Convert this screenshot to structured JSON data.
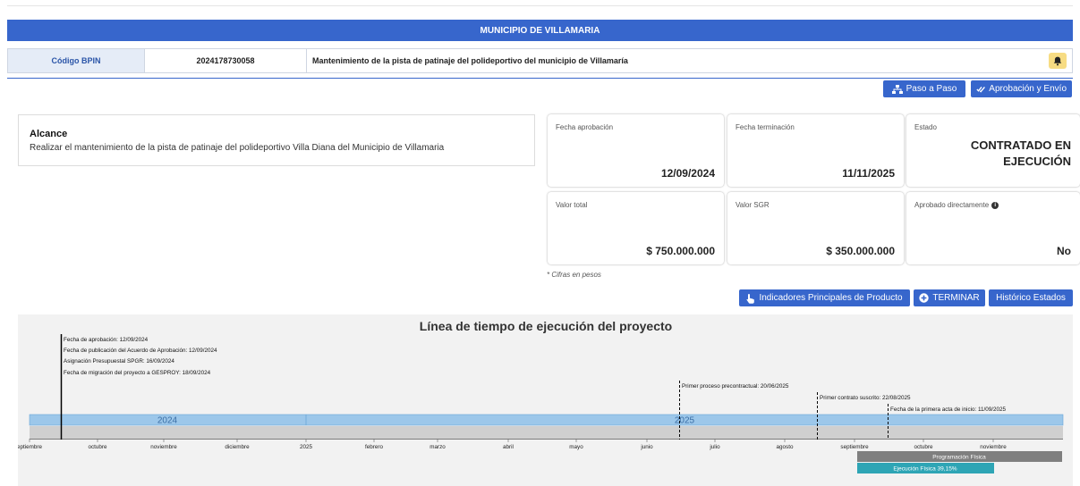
{
  "header": {
    "title": "MUNICIPIO DE VILLAMARIA"
  },
  "bpin": {
    "label": "Código BPIN",
    "code": "2024178730058",
    "description": "Mantenimiento de la pista de patinaje del polideportivo del municipio de Villamaría",
    "bell_icon": "bell-icon"
  },
  "actions": {
    "paso_a_paso": "Paso a Paso",
    "aprobacion_envio": "Aprobación y Envío",
    "indicadores": "Indicadores Principales de Producto",
    "terminar": "TERMINAR",
    "historico": "Histórico Estados"
  },
  "alcance": {
    "title": "Alcance",
    "text": "Realizar el mantenimiento de la pista de patinaje del polideportivo Villa Diana del Municipio de Villamaria"
  },
  "cards": {
    "fecha_aprobacion": {
      "label": "Fecha aprobación",
      "value": "12/09/2024"
    },
    "fecha_terminacion": {
      "label": "Fecha terminación",
      "value": "11/11/2025"
    },
    "estado": {
      "label": "Estado",
      "line1": "CONTRATADO EN",
      "line2": "EJECUCIÓN"
    },
    "valor_total": {
      "label": "Valor total",
      "value": "$ 750.000.000"
    },
    "valor_sgr": {
      "label": "Valor SGR",
      "value": "$ 350.000.000"
    },
    "aprobado_directamente": {
      "label": "Aprobado directamente",
      "value": "No"
    }
  },
  "cifras_note": "* Cifras en pesos",
  "timeline": {
    "title": "Línea de tiempo de ejecución del proyecto",
    "years": [
      "2024",
      "2025"
    ],
    "months": [
      "eptiembre",
      "octubre",
      "noviembre",
      "diciembre",
      "2025",
      "febrero",
      "marzo",
      "abril",
      "mayo",
      "junio",
      "julio",
      "agosto",
      "septiembre",
      "octubre",
      "noviembre"
    ],
    "events_group1": [
      "Fecha de aprobación: 12/09/2024",
      "Fecha de publicación del Acuerdo de Aprobación: 12/09/2024",
      "Asignación Presupuestal SPGR: 16/09/2024",
      "Fecha de migración del proyecto a GESPROY: 18/09/2024"
    ],
    "event_precontractual": "Primer proceso precontractual: 20/06/2025",
    "event_contrato": "Primer contrato suscrito: 22/08/2025",
    "event_acta": "Fecha de la primera acta de inicio: 11/09/2025",
    "programacion": "Programación Física",
    "ejecucion": "Ejecución Física 39,15%",
    "colors": {
      "band": "#9cc7ea",
      "programacion": "#7f7f7f",
      "ejecucion": "#2ea5b5"
    }
  }
}
